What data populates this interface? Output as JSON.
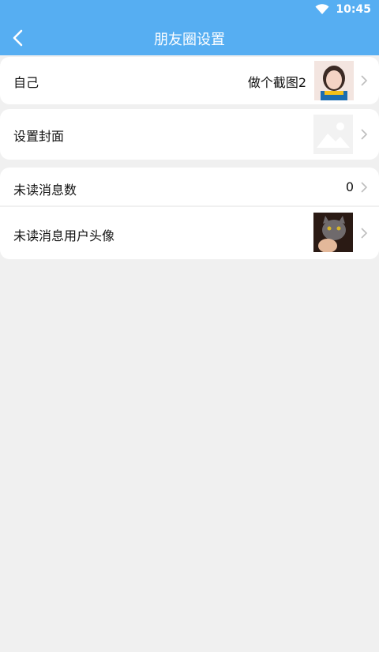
{
  "status_bar": {
    "time": "10:45"
  },
  "header": {
    "title": "朋友圈设置",
    "back_icon": "back-icon"
  },
  "rows": {
    "self": {
      "label": "自己",
      "value": "做个截图2"
    },
    "cover": {
      "label": "设置封面"
    },
    "unread_count": {
      "label": "未读消息数",
      "value": "0"
    },
    "unread_avatar": {
      "label": "未读消息用户头像"
    }
  },
  "colors": {
    "accent": "#56aef2",
    "background": "#f0f0f0",
    "card": "#ffffff"
  }
}
